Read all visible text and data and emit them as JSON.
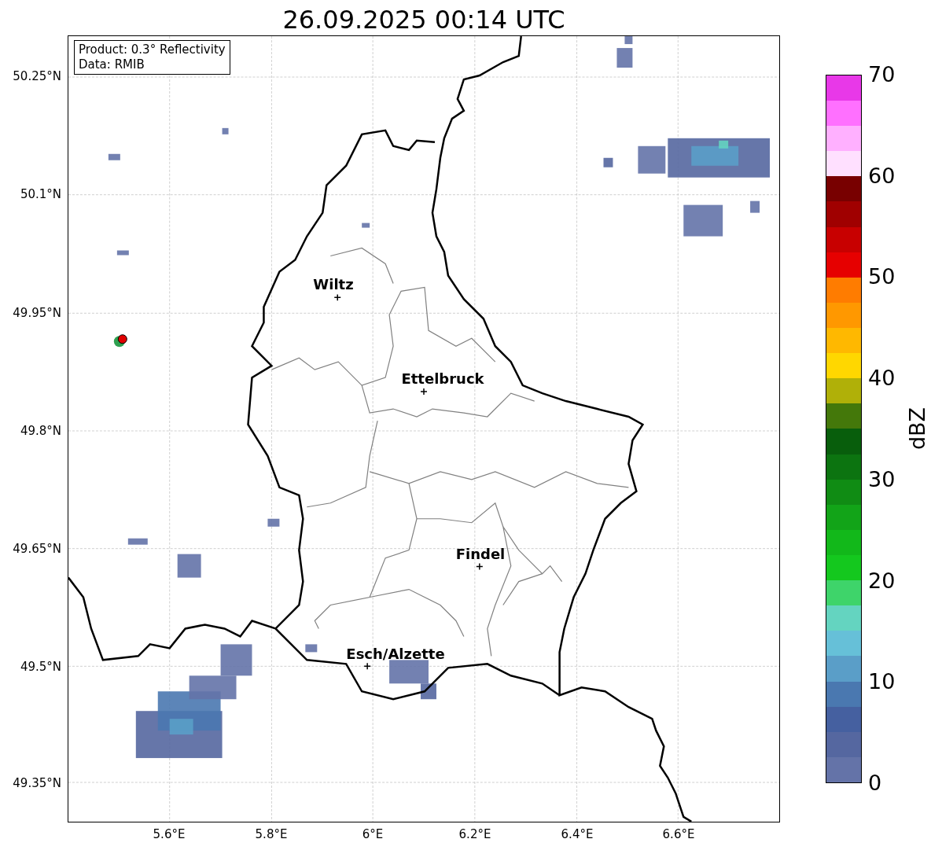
{
  "title": "26.09.2025 00:14 UTC",
  "info_box": [
    "Product: 0.3° Reflectivity",
    "Data: RMIB"
  ],
  "y_ticks": [
    "50.25°N",
    "50.1°N",
    "49.95°N",
    "49.8°N",
    "49.65°N",
    "49.5°N",
    "49.35°N"
  ],
  "x_ticks": [
    "5.6°E",
    "5.8°E",
    "6°E",
    "6.2°E",
    "6.4°E",
    "6.6°E"
  ],
  "cities": [
    {
      "name": "Wiltz"
    },
    {
      "name": "Ettelbruck"
    },
    {
      "name": "Findel"
    },
    {
      "name": "Esch/Alzette"
    }
  ],
  "colorbar": {
    "label": "dBZ",
    "ticks": [
      "70",
      "60",
      "50",
      "40",
      "30",
      "20",
      "10",
      "0"
    ],
    "segments": [
      {
        "color": "#6473a8"
      },
      {
        "color": "#5567a0"
      },
      {
        "color": "#4560a0"
      },
      {
        "color": "#4a78b0"
      },
      {
        "color": "#5a9ec8"
      },
      {
        "color": "#66c0d8"
      },
      {
        "color": "#64d4c0"
      },
      {
        "color": "#3ed46a"
      },
      {
        "color": "#14c81e"
      },
      {
        "color": "#12b81a"
      },
      {
        "color": "#12a418"
      },
      {
        "color": "#108c14"
      },
      {
        "color": "#0c7410"
      },
      {
        "color": "#085e0c"
      },
      {
        "color": "#44780a"
      },
      {
        "color": "#b0b008"
      },
      {
        "color": "#ffd700"
      },
      {
        "color": "#ffb800"
      },
      {
        "color": "#ff9800"
      },
      {
        "color": "#ff7c00"
      },
      {
        "color": "#e60000"
      },
      {
        "color": "#c80000"
      },
      {
        "color": "#a00000"
      },
      {
        "color": "#780000"
      },
      {
        "color": "#ffe0ff"
      },
      {
        "color": "#ffb0ff"
      },
      {
        "color": "#ff70ff"
      },
      {
        "color": "#e838e8"
      }
    ]
  }
}
